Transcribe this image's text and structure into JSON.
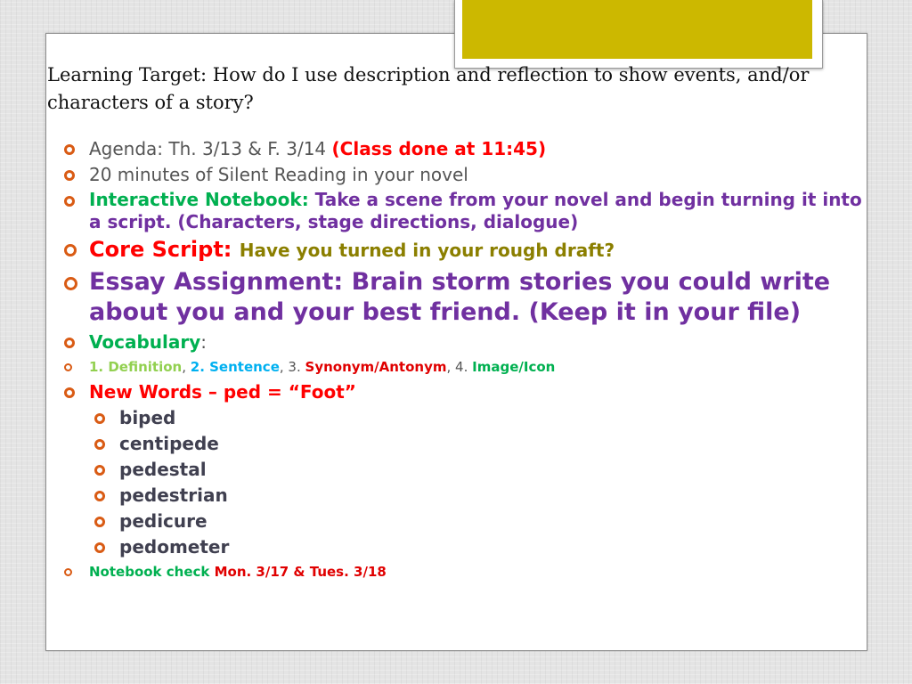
{
  "title": "Learning Target: How do I use description and reflection to show events, and/or characters of a story?",
  "colors": {
    "accent_bar": "#ccb800",
    "bullet": "#d95b14",
    "purple": "#7030a0",
    "green": "#00b050",
    "red": "#ff0000",
    "olive": "#8b7f00",
    "light_green": "#92d050",
    "blue": "#00b0f0"
  },
  "bullets": {
    "agenda": {
      "label": "Agenda: Th. 3/13 & F. 3/14 ",
      "note": "(Class done at 11:45)"
    },
    "reading": "20 minutes of Silent Reading in your novel",
    "notebook": {
      "label": "Interactive Notebook: ",
      "text": "Take a scene from your novel and begin turning it into a script. (Characters, stage directions, dialogue)"
    },
    "core": {
      "label": "Core Script: ",
      "text": "Have you turned in your rough draft?"
    },
    "essay": "Essay Assignment: Brain storm stories you could write about you and your best friend. (Keep it in your file)",
    "vocab": {
      "label": "Vocabulary",
      "colon": ":"
    },
    "vocab_steps": {
      "s1": "1. Definition",
      "sep1": ",  ",
      "s2": "2. Sentence",
      "sep2": ",  ",
      "n3": "3. ",
      "s3": "Synonym/Antonym",
      "sep3": ",  ",
      "n4": "4. ",
      "s4": "Image/Icon"
    },
    "new_words": "New Words – ped = “Foot”",
    "words": [
      "biped",
      "centipede",
      "pedestal",
      "pedestrian",
      "pedicure",
      "pedometer"
    ],
    "notebook_check": {
      "label": "Notebook check ",
      "date": "Mon. 3/17 & Tues. 3/18"
    }
  }
}
